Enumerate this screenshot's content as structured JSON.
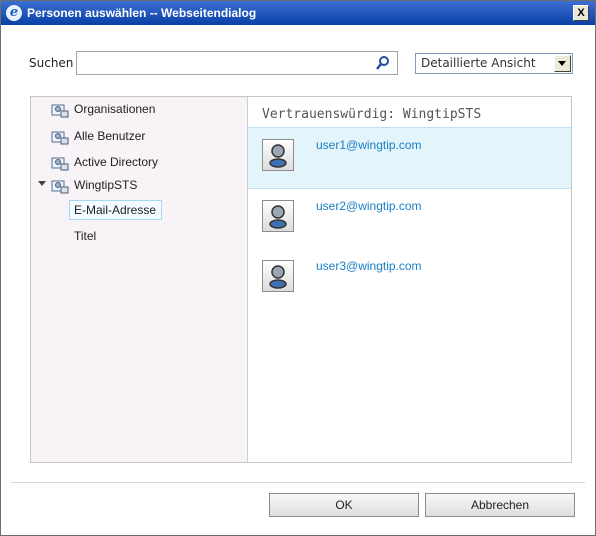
{
  "window": {
    "title": "Personen auswählen -- Webseitendialog",
    "close_glyph": "X"
  },
  "search": {
    "label": "Suchen",
    "value": "",
    "placeholder": ""
  },
  "view": {
    "selected": "Detaillierte Ansicht"
  },
  "tree": {
    "items": [
      {
        "label": "Organisationen",
        "icon": "directory-group-icon"
      },
      {
        "label": "Alle Benutzer",
        "icon": "directory-group-icon"
      },
      {
        "label": "Active Directory",
        "icon": "directory-group-icon"
      },
      {
        "label": "WingtipSTS",
        "icon": "directory-group-icon",
        "expanded": true
      }
    ],
    "subitems": [
      {
        "label": "E-Mail-Adresse",
        "selected": true
      },
      {
        "label": "Titel",
        "selected": false
      }
    ]
  },
  "results": {
    "header": "Vertrauenswürdig: WingtipSTS",
    "items": [
      {
        "name": "user1@wingtip.com",
        "selected": true
      },
      {
        "name": "user2@wingtip.com",
        "selected": false
      },
      {
        "name": "user3@wingtip.com",
        "selected": false
      }
    ]
  },
  "buttons": {
    "ok": "OK",
    "cancel": "Abbrechen"
  },
  "colors": {
    "title_bar": "#0a3fa6",
    "link": "#1a7fc6",
    "selection": "#e4f4fb",
    "tree_bg": "#f7f3f7"
  }
}
